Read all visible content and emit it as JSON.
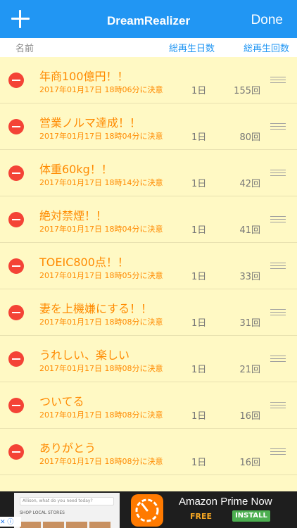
{
  "navbar": {
    "title": "DreamRealizer",
    "done_label": "Done",
    "add_icon": "plus-icon"
  },
  "columns": {
    "name": "名前",
    "days": "総再生日数",
    "total": "総再生回数"
  },
  "items": [
    {
      "goal": "年商100億円！！",
      "date": "2017年01月17日 18時06分に決意",
      "days": "1日",
      "count": "155回"
    },
    {
      "goal": "営業ノルマ達成！！",
      "date": "2017年01月17日 18時04分に決意",
      "days": "1日",
      "count": "80回"
    },
    {
      "goal": "体重60kg！！",
      "date": "2017年01月17日 18時14分に決意",
      "days": "1日",
      "count": "42回"
    },
    {
      "goal": "絶対禁煙！！",
      "date": "2017年01月17日 18時04分に決意",
      "days": "1日",
      "count": "41回"
    },
    {
      "goal": "TOEIC800点！！",
      "date": "2017年01月17日 18時05分に決意",
      "days": "1日",
      "count": "33回"
    },
    {
      "goal": "妻を上機嫌にする！！",
      "date": "2017年01月17日 18時08分に決意",
      "days": "1日",
      "count": "31回"
    },
    {
      "goal": "うれしい、楽しい",
      "date": "2017年01月17日 18時08分に決意",
      "days": "1日",
      "count": "21回"
    },
    {
      "goal": "ついてる",
      "date": "2017年01月17日 18時08分に決意",
      "days": "1日",
      "count": "16回"
    },
    {
      "goal": "ありがとう",
      "date": "2017年01月17日 18時08分に決意",
      "days": "1日",
      "count": "16回"
    }
  ],
  "ad": {
    "search_placeholder": "Allison, what do you need today?",
    "shop_label": "SHOP LOCAL STORES",
    "title": "Amazon Prime Now",
    "price": "FREE",
    "install_label": "INSTALL"
  },
  "colors": {
    "nav": "#2196f3",
    "list_bg": "#fff9c4",
    "text_accent": "#ff8a00",
    "delete": "#f44336"
  }
}
